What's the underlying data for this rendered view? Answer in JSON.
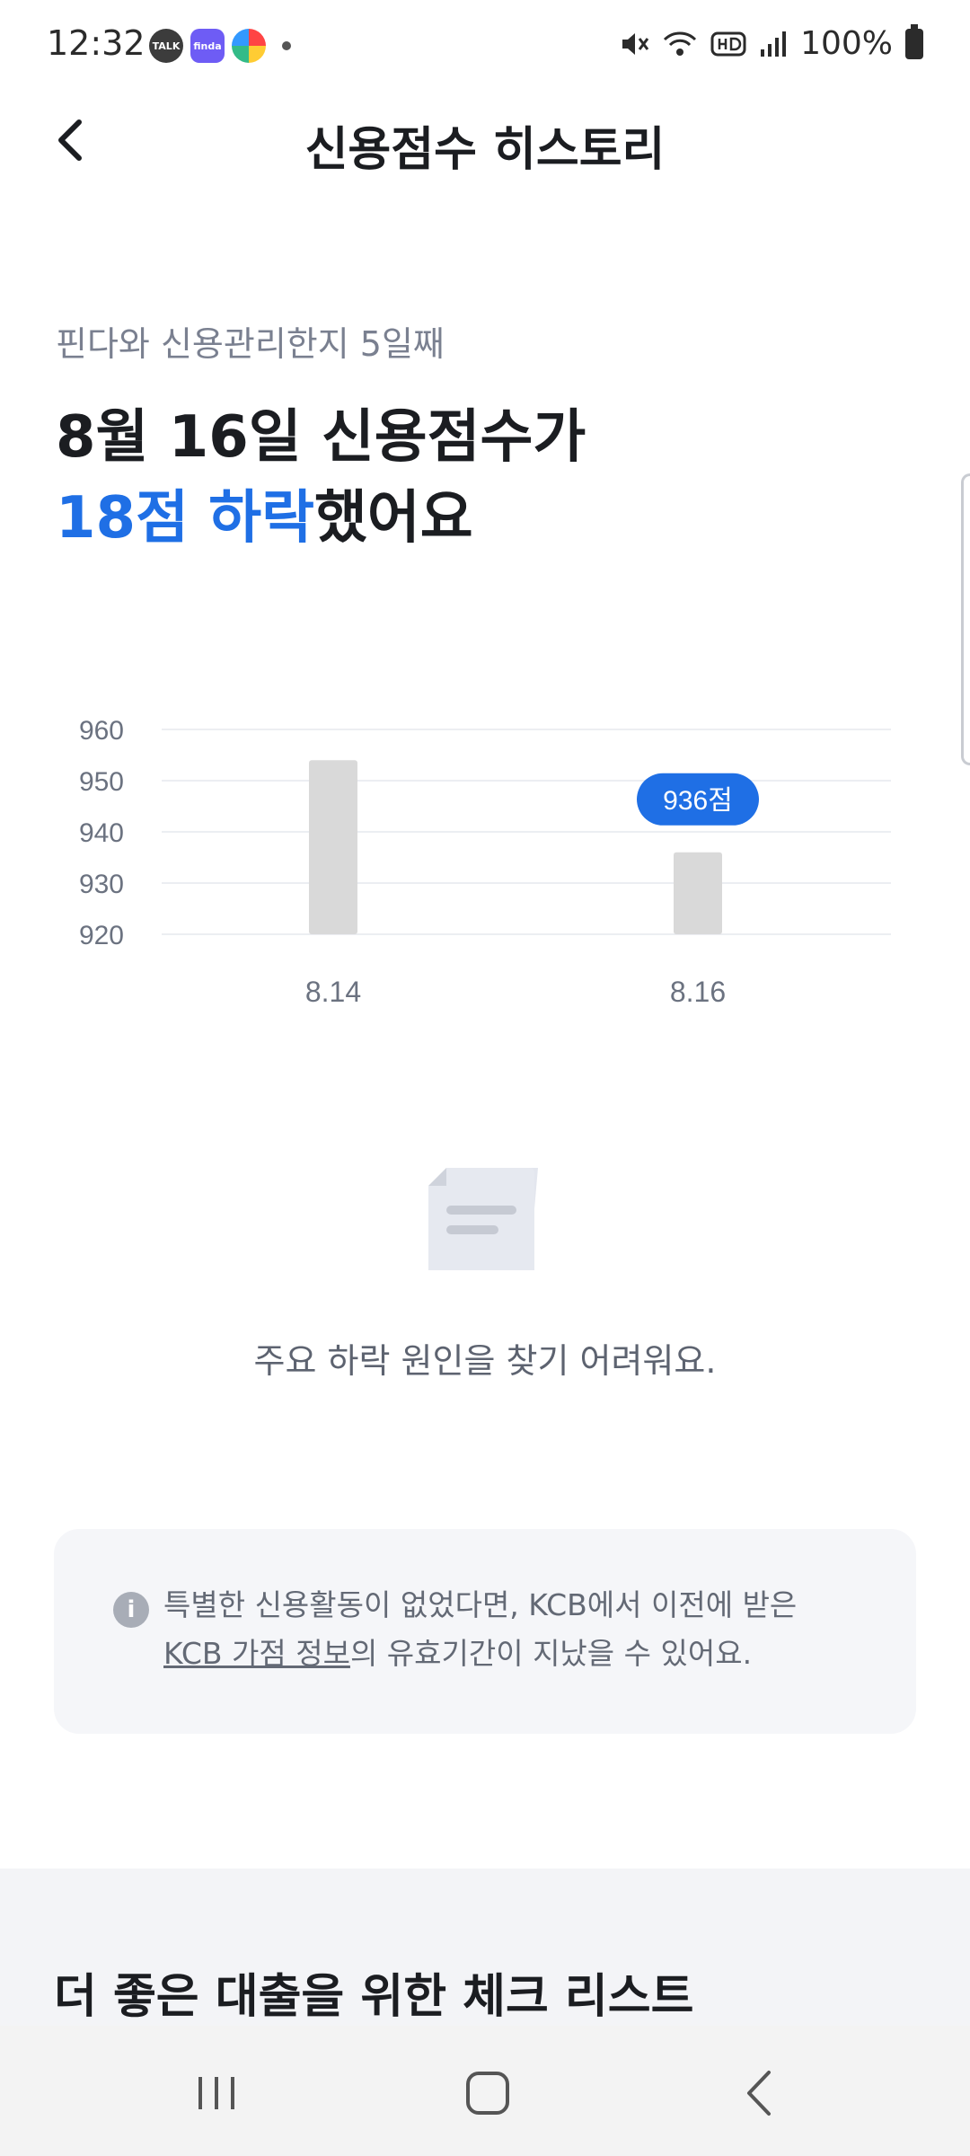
{
  "status_bar": {
    "time": "12:32",
    "apps": [
      "TALK",
      "finda",
      ""
    ],
    "battery": "100%"
  },
  "header": {
    "title": "신용점수 히스토리"
  },
  "summary": {
    "subtitle": "핀다와 신용관리한지 5일째",
    "line1": "8월 16일 신용점수가",
    "change": "18점 하락",
    "suffix": "했어요"
  },
  "chart_data": {
    "type": "bar",
    "categories": [
      "8.14",
      "8.16"
    ],
    "values": [
      954,
      936
    ],
    "yticks": [
      960,
      950,
      940,
      930,
      920
    ],
    "ylim": [
      920,
      960
    ],
    "grid": true,
    "highlight": {
      "index": 1,
      "label": "936점"
    },
    "bar_color": "#d9d9d9",
    "highlight_color": "#1f6fe5"
  },
  "empty_state": {
    "message": "주요 하락 원인을 찾기 어려워요."
  },
  "info": {
    "text_before": "특별한 신용활동이 없었다면, KCB에서 이전에 받은",
    "link": "KCB 가점 정보",
    "text_after": "의 유효기간이 지났을 수 있어요."
  },
  "section": {
    "title": "더 좋은 대출을 위한 체크 리스트"
  },
  "colors": {
    "accent": "#1f6fe5",
    "text_primary": "#1b1d21",
    "text_secondary": "#7a8090"
  }
}
